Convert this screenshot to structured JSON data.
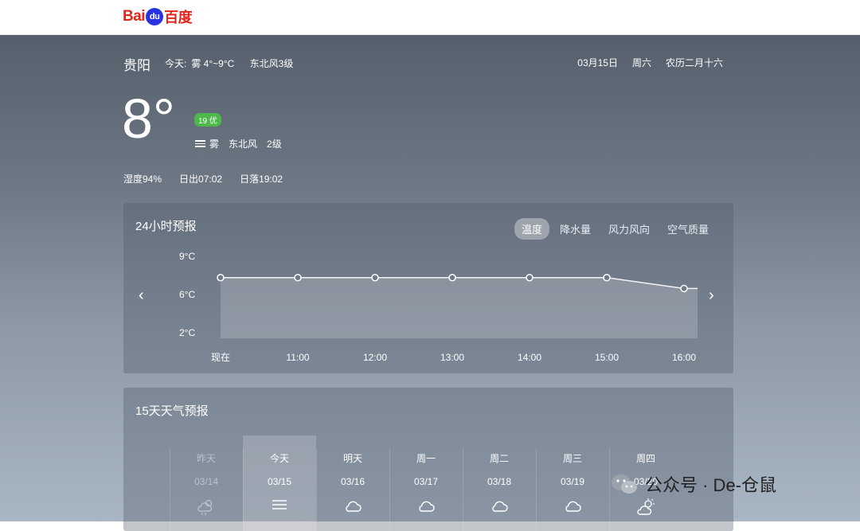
{
  "logo": {
    "part1": "Bai",
    "part2": "du",
    "part3": "百度"
  },
  "header": {
    "city": "贵阳",
    "today_label": "今天:",
    "today_weather": "雾 4°~9°C",
    "today_wind": "东北风3级",
    "date": "03月15日",
    "weekday": "周六",
    "lunar": "农历二月十六"
  },
  "current": {
    "temp": "8°",
    "aqi": "19 优",
    "condition": "雾",
    "wind_dir": "东北风",
    "wind_level": "2级",
    "humidity": "湿度94%",
    "sunrise": "日出07:02",
    "sunset": "日落19:02"
  },
  "hourly": {
    "title": "24小时预报",
    "tabs": [
      "温度",
      "降水量",
      "风力风向",
      "空气质量"
    ],
    "active_tab": "温度",
    "prev": "‹",
    "next": "›"
  },
  "chart_data": {
    "type": "area",
    "categories": [
      "现在",
      "11:00",
      "12:00",
      "13:00",
      "14:00",
      "15:00",
      "16:00"
    ],
    "values": [
      8,
      8,
      8,
      8,
      8,
      8,
      7
    ],
    "y_ticks": [
      "9°C",
      "6°C",
      "2°C"
    ],
    "tick_values": [
      9,
      6,
      2
    ],
    "ylim": [
      2,
      9
    ]
  },
  "daily": {
    "title": "15天天气预报",
    "days": [
      {
        "name": "昨天",
        "date": "03/14",
        "icon": "sun-cloud-rain-icon"
      },
      {
        "name": "今天",
        "date": "03/15",
        "icon": "fog-icon"
      },
      {
        "name": "明天",
        "date": "03/16",
        "icon": "cloud-icon"
      },
      {
        "name": "周一",
        "date": "03/17",
        "icon": "cloud-icon"
      },
      {
        "name": "周二",
        "date": "03/18",
        "icon": "cloud-icon"
      },
      {
        "name": "周三",
        "date": "03/19",
        "icon": "cloud-icon"
      },
      {
        "name": "周四",
        "date": "03/20",
        "icon": "sun-cloud-icon"
      }
    ]
  },
  "watermark": {
    "text": "公众号 · De-仓鼠"
  }
}
